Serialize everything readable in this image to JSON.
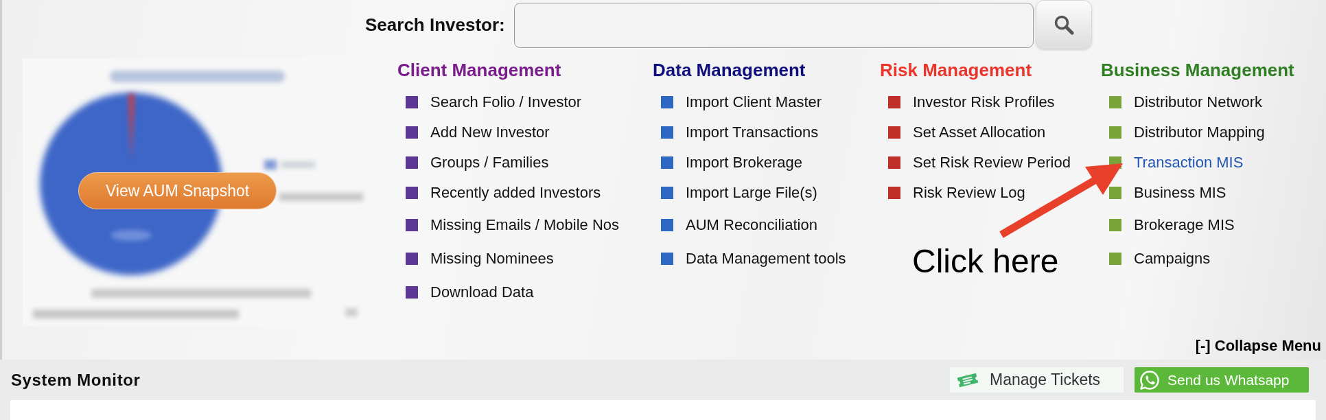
{
  "search": {
    "label": "Search Investor:"
  },
  "snapshot": {
    "button": "View AUM Snapshot"
  },
  "menu_columns": [
    {
      "title": "Client Management",
      "color": "#7a1c8c",
      "bullet": {
        "color": "#5e3696"
      },
      "items": [
        {
          "label": "Search Folio / Investor",
          "highlighted": false
        },
        {
          "label": "Add New Investor",
          "highlighted": false
        },
        {
          "label": "Groups / Families",
          "highlighted": false
        },
        {
          "label": "Recently added Investors",
          "highlighted": false
        },
        {
          "label": "Missing Emails / Mobile Nos",
          "highlighted": false
        },
        {
          "label": "Missing Nominees",
          "highlighted": false
        },
        {
          "label": "Download Data",
          "highlighted": false
        }
      ]
    },
    {
      "title": "Data Management",
      "color": "#0e0e7e",
      "bullet": {
        "color": "#2d66c3"
      },
      "items": [
        {
          "label": "Import Client Master",
          "highlighted": false
        },
        {
          "label": "Import Transactions",
          "highlighted": false
        },
        {
          "label": "Import Brokerage",
          "highlighted": false
        },
        {
          "label": "Import Large File(s)",
          "highlighted": false
        },
        {
          "label": "AUM Reconciliation",
          "highlighted": false
        },
        {
          "label": "Data Management tools",
          "highlighted": false
        }
      ]
    },
    {
      "title": "Risk Management",
      "color": "#e9352b",
      "bullet": {
        "color": "#bf2e27"
      },
      "items": [
        {
          "label": "Investor Risk Profiles",
          "highlighted": false
        },
        {
          "label": "Set Asset Allocation",
          "highlighted": false
        },
        {
          "label": "Set Risk Review Period",
          "highlighted": false
        },
        {
          "label": "Risk Review Log",
          "highlighted": false
        }
      ]
    },
    {
      "title": "Business Management",
      "color": "#2f7f22",
      "bullet": {
        "color": "#78a43a"
      },
      "items": [
        {
          "label": "Distributor Network",
          "highlighted": false
        },
        {
          "label": "Distributor Mapping",
          "highlighted": false
        },
        {
          "label": "Transaction MIS",
          "highlighted": true
        },
        {
          "label": "Business MIS",
          "highlighted": false
        },
        {
          "label": "Brokerage MIS",
          "highlighted": false
        },
        {
          "label": "Campaigns",
          "highlighted": false
        }
      ]
    }
  ],
  "annotation": {
    "text": "Click here"
  },
  "collapse_link": "[-] Collapse Menu",
  "system_monitor": {
    "title": "System Monitor",
    "buttons": [
      {
        "kind": "tickets",
        "label": "Manage Tickets"
      },
      {
        "kind": "whatsapp",
        "label": "Send us Whatsapp"
      }
    ]
  }
}
